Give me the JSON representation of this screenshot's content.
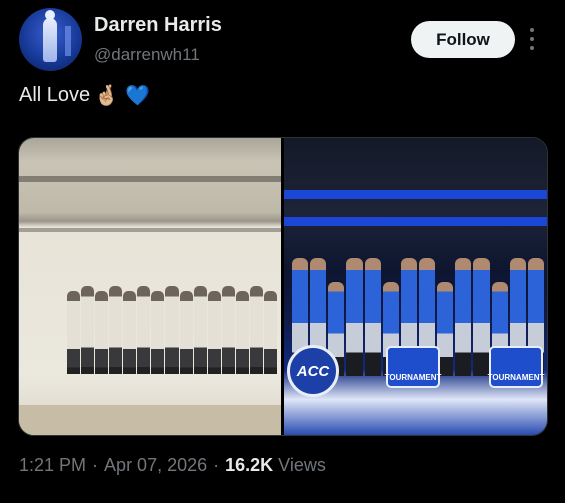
{
  "author": {
    "name": "Darren Harris",
    "handle": "@darrenwh11",
    "avatar_icon": "profile-avatar"
  },
  "actions": {
    "follow_label": "Follow",
    "more_icon": "more-vertical-icon"
  },
  "tweet": {
    "text": "All Love",
    "emojis": [
      "🤞🏼",
      "💙"
    ]
  },
  "media": {
    "left_photo": "team-photo-studio",
    "right_photo": "team-celebration-acc",
    "right_overlay": {
      "badge": "ACC",
      "sign_text": "TOURNAMENT"
    }
  },
  "meta": {
    "time": "1:21 PM",
    "date": "Apr 07, 2026",
    "views_count": "16.2K",
    "views_label": "Views",
    "separator": "·"
  },
  "colors": {
    "background": "#000000",
    "text_primary": "#e7e9ea",
    "text_secondary": "#71767b",
    "follow_bg": "#eff3f4",
    "accent_blue": "#1d9bf0"
  }
}
